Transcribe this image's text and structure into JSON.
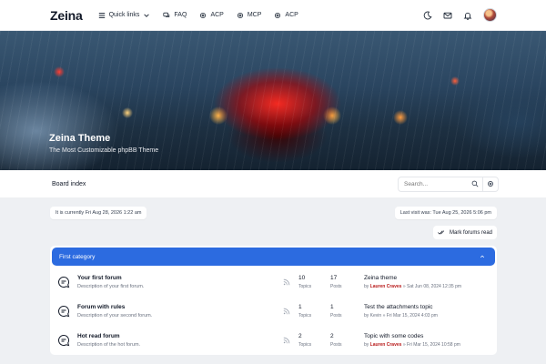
{
  "nav": {
    "logo": "Zeina",
    "links": [
      {
        "label": "Quick links",
        "icon": "menu-icon"
      },
      {
        "label": "FAQ",
        "icon": "chat-icon"
      },
      {
        "label": "ACP",
        "icon": "gear-icon"
      },
      {
        "label": "MCP",
        "icon": "gear-icon"
      },
      {
        "label": "ACP",
        "icon": "gear-icon"
      }
    ]
  },
  "hero": {
    "title": "Zeina Theme",
    "subtitle": "The Most Customizable phpBB Theme"
  },
  "breadcrumb": {
    "label": "Board index"
  },
  "search": {
    "placeholder": "Search..."
  },
  "info": {
    "current_time": "It is currently Fri Aug 28, 2026 1:22 am",
    "last_visit": "Last visit was: Tue Aug 25, 2026 5:06 pm",
    "mark_read": "Mark forums read"
  },
  "category": {
    "title": "First category",
    "forums": [
      {
        "title": "Your first forum",
        "description": "Description of your first forum.",
        "topics": "10",
        "topics_label": "Topics",
        "posts": "17",
        "posts_label": "Posts",
        "last_title": "Zeina theme",
        "last_by": "by",
        "last_user": "Lauren Craves",
        "last_date": "» Sat Jun 08, 2024 12:35 pm"
      },
      {
        "title": "Forum with rules",
        "description": "Description of your second forum.",
        "topics": "1",
        "topics_label": "Topics",
        "posts": "1",
        "posts_label": "Posts",
        "last_title": "Test the attachments topic",
        "last_by": "by",
        "last_user": "Kevin",
        "last_date": "» Fri Mar 15, 2024 4:03 pm"
      },
      {
        "title": "Hot read forum",
        "description": "Description of the hot forum.",
        "topics": "2",
        "topics_label": "Topics",
        "posts": "2",
        "posts_label": "Posts",
        "last_title": "Topic with some codes",
        "last_by": "by",
        "last_user": "Lauren Craves",
        "last_date": "» Fri Mar 15, 2024 10:58 pm"
      }
    ]
  },
  "colors": {
    "accent": "#2c6be0",
    "username": "#b91c1c"
  }
}
